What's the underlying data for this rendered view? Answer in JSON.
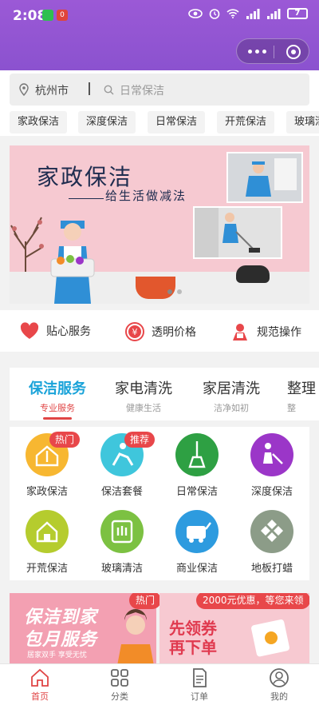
{
  "status_bar": {
    "time": "2:08",
    "battery": "7"
  },
  "capsule": {
    "more": "more",
    "close": "close"
  },
  "search": {
    "city": "杭州市",
    "placeholder": "日常保洁"
  },
  "chips": [
    "家政保洁",
    "深度保洁",
    "日常保洁",
    "开荒保洁",
    "玻璃清"
  ],
  "banner": {
    "title": "家政保洁",
    "subtitle": "给生活做减法"
  },
  "features": [
    {
      "label": "贴心服务",
      "icon": "heart-icon"
    },
    {
      "label": "透明价格",
      "icon": "yen-icon"
    },
    {
      "label": "规范操作",
      "icon": "worker-icon"
    }
  ],
  "tabs": [
    {
      "title": "保洁服务",
      "sub": "专业服务",
      "active": true
    },
    {
      "title": "家电清洗",
      "sub": "健康生活"
    },
    {
      "title": "家居清洗",
      "sub": "洁净如初"
    },
    {
      "title": "整理",
      "sub": "整"
    }
  ],
  "grid": [
    {
      "label": "家政保洁",
      "tag": "热门",
      "color": "#f7b731"
    },
    {
      "label": "保洁套餐",
      "tag": "推荐",
      "color": "#3fc6dc"
    },
    {
      "label": "日常保洁",
      "color": "#2ea043"
    },
    {
      "label": "深度保洁",
      "color": "#9b36c8"
    },
    {
      "label": "开荒保洁",
      "color": "#b5cc2e"
    },
    {
      "label": "玻璃清洁",
      "color": "#7cc142"
    },
    {
      "label": "商业保洁",
      "color": "#2d9bdf"
    },
    {
      "label": "地板打蜡",
      "color": "#8c9c88"
    }
  ],
  "promo": {
    "left_line1": "保洁到家",
    "left_line2": "包月服务",
    "left_small": "居家双手 享受无忧",
    "hot_tag": "热门",
    "coupon_tag": "2000元优惠，等您来领",
    "right_line1": "先领券",
    "right_line2": "再下单"
  },
  "nav": [
    {
      "label": "首页",
      "active": true
    },
    {
      "label": "分类"
    },
    {
      "label": "订单"
    },
    {
      "label": "我的"
    }
  ],
  "colors": {
    "header": "#9b59d6",
    "accent": "#1aa3d9",
    "red": "#e04545"
  }
}
